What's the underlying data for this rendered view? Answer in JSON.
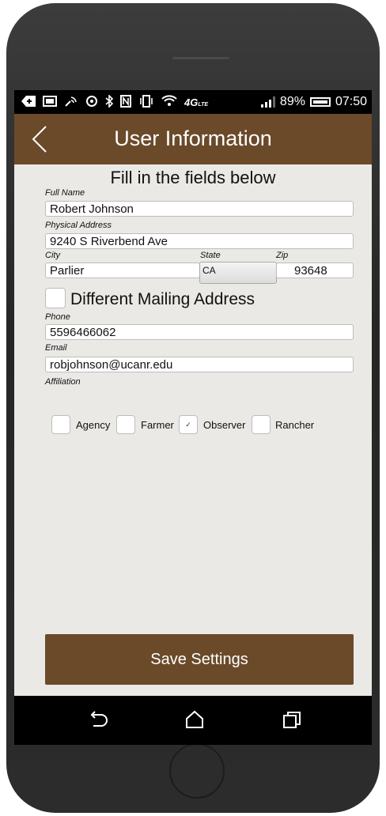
{
  "status_bar": {
    "battery_pct": "89%",
    "time": "07:50",
    "network": "4G",
    "network_sub": "LTE"
  },
  "app_bar": {
    "title": "User Information"
  },
  "form": {
    "heading": "Fill in the fields below",
    "full_name": {
      "label": "Full Name",
      "value": "Robert Johnson"
    },
    "address": {
      "label": "Physical Address",
      "value": "9240 S Riverbend Ave"
    },
    "city": {
      "label": "City",
      "value": "Parlier"
    },
    "state": {
      "label": "State",
      "value": "CA"
    },
    "zip": {
      "label": "Zip",
      "value": "93648"
    },
    "mailing": {
      "label": "Different Mailing Address",
      "checked": false
    },
    "phone": {
      "label": "Phone",
      "value": "5596466062"
    },
    "email": {
      "label": "Email",
      "value": "robjohnson@ucanr.edu"
    },
    "affiliation": {
      "label": "Affiliation",
      "options": [
        {
          "label": "Agency",
          "checked": false
        },
        {
          "label": "Farmer",
          "checked": false
        },
        {
          "label": "Observer",
          "checked": true,
          "mark": "✓"
        },
        {
          "label": "Rancher",
          "checked": false
        }
      ]
    }
  },
  "save_button": {
    "label": "Save Settings"
  },
  "colors": {
    "brand": "#6b4a2a",
    "background": "#ebe9e5"
  }
}
